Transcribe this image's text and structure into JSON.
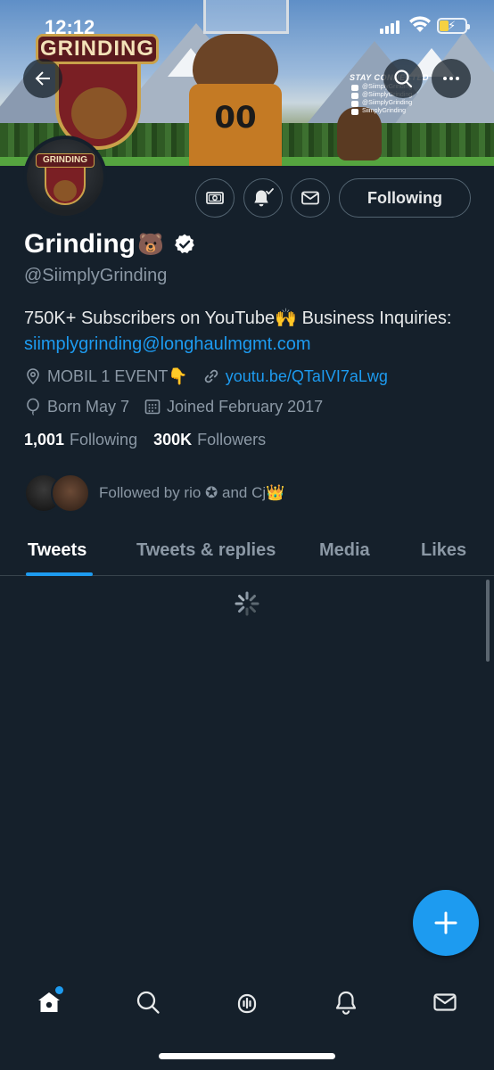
{
  "status_bar": {
    "time": "12:12"
  },
  "banner": {
    "logo_text": "GRINDING",
    "jersey_number": "00",
    "stay_connected": "STAY CONNECTED",
    "socials": [
      "@SiimplyGrinding",
      "@SiimplyGrinding",
      "@SiimplyGrinding",
      "SiimplyGrinding"
    ]
  },
  "avatar": {
    "logo_text": "GRINDING"
  },
  "profile": {
    "name": "Grinding",
    "name_emoji": "🐻",
    "handle": "@SiimplyGrinding",
    "bio_text": "750K+ Subscribers on YouTube🙌 Business Inquiries: ",
    "bio_email": "siimplygrinding@longhaulmgmt.com",
    "location": "MOBIL 1 EVENT👇",
    "website": "youtu.be/QTaIVI7aLwg",
    "birthday": "Born May 7",
    "joined": "Joined February 2017",
    "following_count": "1,001",
    "following_label": "Following",
    "followers_count": "300K",
    "followers_label": "Followers",
    "followed_by": "Followed by rio ✪ and Cj👑"
  },
  "actions": {
    "follow_label": "Following"
  },
  "tabs": [
    {
      "label": "Tweets",
      "active": true
    },
    {
      "label": "Tweets & replies",
      "active": false
    },
    {
      "label": "Media",
      "active": false
    },
    {
      "label": "Likes",
      "active": false
    }
  ],
  "bottom_nav": [
    "home-icon",
    "search-icon",
    "spaces-icon",
    "notifications-icon",
    "messages-icon"
  ],
  "colors": {
    "accent": "#1d9bf0",
    "background": "#15202b",
    "muted": "#8b98a5",
    "border": "#38444d"
  }
}
